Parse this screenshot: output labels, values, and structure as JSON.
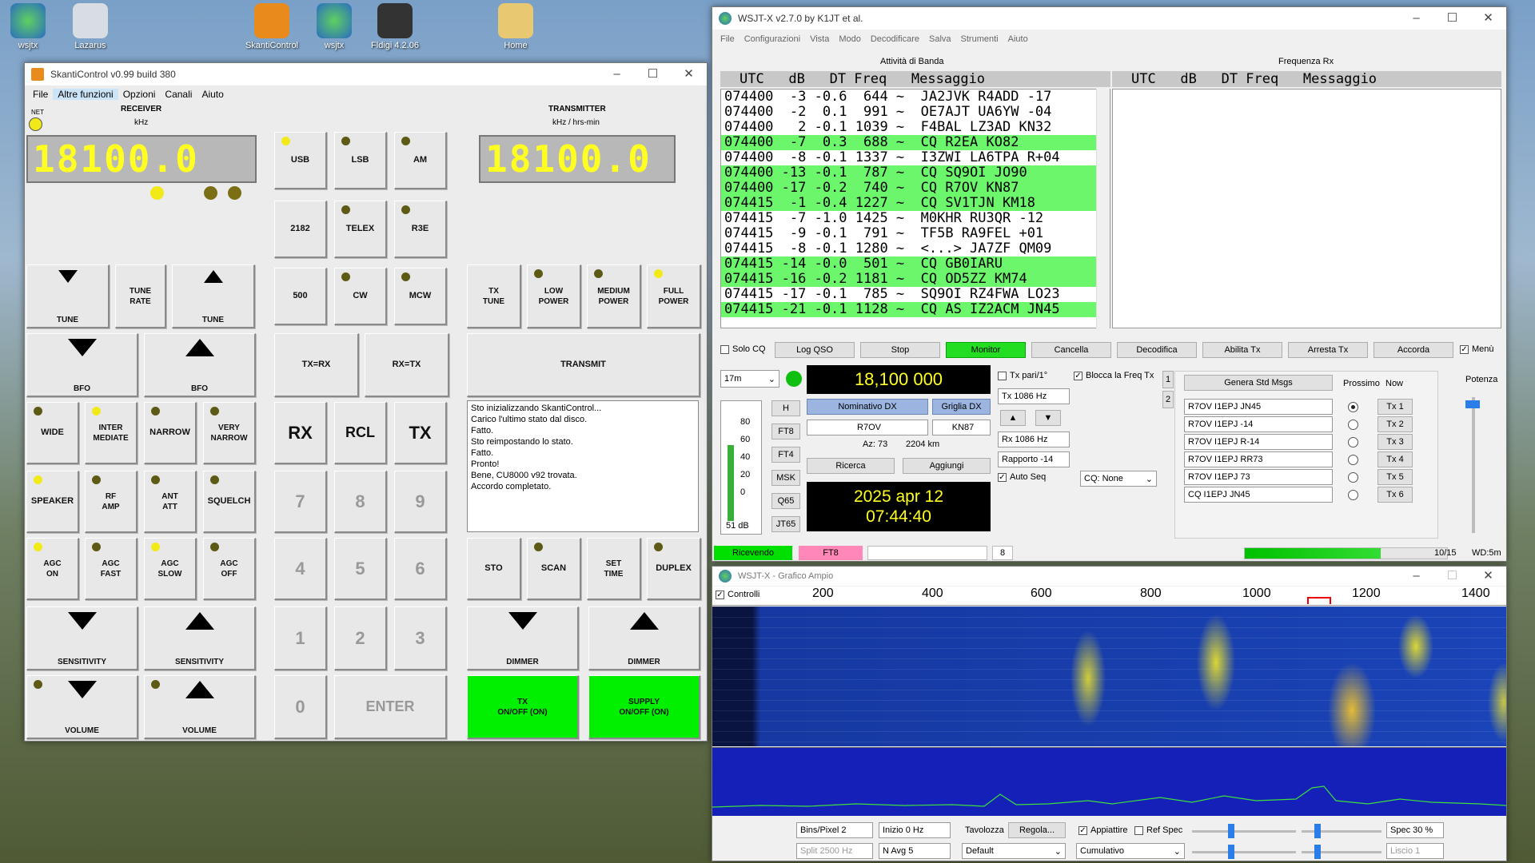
{
  "desktop": {
    "icons": [
      {
        "label": "wsjtx",
        "color": "#3a7bd5"
      },
      {
        "label": "Lazarus",
        "color": "#d8dde3"
      },
      {
        "label": "SkantiControl",
        "color": "#e88a1c"
      },
      {
        "label": "wsjtx",
        "color": "#3a7bd5"
      },
      {
        "label": "Fldigi 4.2.06",
        "color": "#333333"
      },
      {
        "label": "Home",
        "color": "#e8c870"
      }
    ]
  },
  "skanti": {
    "title": "SkantiControl v0.99 build 380",
    "menu": [
      "File",
      "Altre funzioni",
      "Opzioni",
      "Canali",
      "Aiuto"
    ],
    "receiver_label": "RECEIVER",
    "receiver_unit": "kHz",
    "net_label": "NET",
    "transmitter_label": "TRANSMITTER",
    "transmitter_unit": "kHz / hrs-min",
    "rx_freq": "18100.0",
    "tx_freq": "18100.0",
    "buttons": {
      "usb": "USB",
      "lsb": "LSB",
      "am": "AM",
      "f2182": "2182",
      "telex": "TELEX",
      "r3e": "R3E",
      "f500": "500",
      "cw": "CW",
      "mcw": "MCW",
      "tune_down": "TUNE",
      "tune_rate": "TUNE\nRATE",
      "tune_up": "TUNE",
      "tx_tune": "TX\nTUNE",
      "low_power": "LOW\nPOWER",
      "medium_power": "MEDIUM\nPOWER",
      "full_power": "FULL\nPOWER",
      "bfo_down": "BFO",
      "bfo_up": "BFO",
      "txrx": "TX=RX",
      "rxtx": "RX=TX",
      "transmit": "TRANSMIT",
      "wide": "WIDE",
      "intermediate": "INTER\nMEDIATE",
      "narrow": "NARROW",
      "very_narrow": "VERY\nNARROW",
      "rx": "RX",
      "rcl": "RCL",
      "tx": "TX",
      "speaker": "SPEAKER",
      "rf_amp": "RF\nAMP",
      "ant_att": "ANT\nATT",
      "squelch": "SQUELCH",
      "agc_on": "AGC\nON",
      "agc_fast": "AGC\nFAST",
      "agc_slow": "AGC\nSLOW",
      "agc_off": "AGC\nOFF",
      "sto": "STO",
      "scan": "SCAN",
      "set_time": "SET\nTIME",
      "duplex": "DUPLEX",
      "sens_down": "SENSITIVITY",
      "sens_up": "SENSITIVITY",
      "dimmer_down": "DIMMER",
      "dimmer_up": "DIMMER",
      "vol_down": "VOLUME",
      "vol_up": "VOLUME",
      "tx_onoff": "TX\nON/OFF (ON)",
      "supply_onoff": "SUPPLY\nON/OFF (ON)",
      "k7": "7",
      "k8": "8",
      "k9": "9",
      "k4": "4",
      "k5": "5",
      "k6": "6",
      "k1": "1",
      "k2": "2",
      "k3": "3",
      "k0": "0",
      "enter": "ENTER"
    },
    "log": [
      "Sto inizializzando SkantiControl...",
      "Carico l'ultimo stato dal disco.",
      "Fatto.",
      "Sto reimpostando lo stato.",
      "Fatto.",
      "Pronto!",
      "Bene, CU8000 v92 trovata.",
      "Accordo completato."
    ]
  },
  "wsjtx": {
    "title": "WSJT-X   v2.7.0   by K1JT et al.",
    "menu": [
      "File",
      "Configurazioni",
      "Vista",
      "Modo",
      "Decodificare",
      "Salva",
      "Strumenti",
      "Aiuto"
    ],
    "band_activity_label": "Attività di Banda",
    "rx_freq_label": "Frequenza Rx",
    "col_header": "UTC   dB   DT Freq   Messaggio",
    "decodes": [
      {
        "text": "074400  -3 -0.6  644 ~  JA2JVK R4ADD -17",
        "cq": false
      },
      {
        "text": "074400  -2  0.1  991 ~  OE7AJT UA6YW -04",
        "cq": false
      },
      {
        "text": "074400   2 -0.1 1039 ~  F4BAL LZ3AD KN32",
        "cq": false
      },
      {
        "text": "074400  -7  0.3  688 ~  CQ R2EA KO82",
        "cq": true
      },
      {
        "text": "074400  -8 -0.1 1337 ~  I3ZWI LA6TPA R+04",
        "cq": false
      },
      {
        "text": "074400 -13 -0.1  787 ~  CQ SQ9OI JO90",
        "cq": true
      },
      {
        "text": "074400 -17 -0.2  740 ~  CQ R7OV KN87",
        "cq": true
      },
      {
        "text": "074415  -1 -0.4 1227 ~  CQ SV1TJN KM18",
        "cq": true
      },
      {
        "text": "074415  -7 -1.0 1425 ~  M0KHR RU3QR -12",
        "cq": false
      },
      {
        "text": "074415  -9 -0.1  791 ~  TF5B RA9FEL +01",
        "cq": false
      },
      {
        "text": "074415  -8 -0.1 1280 ~  <...> JA7ZF QM09",
        "cq": false
      },
      {
        "text": "074415 -14 -0.0  501 ~  CQ GB0IARU",
        "cq": true
      },
      {
        "text": "074415 -16 -0.2 1181 ~  CQ OD5ZZ KM74",
        "cq": true
      },
      {
        "text": "074415 -17 -0.1  785 ~  SQ9OI RZ4FWA LO23",
        "cq": false
      },
      {
        "text": "074415 -21 -0.1 1128 ~  CQ AS IZ2ACM JN45",
        "cq": true
      }
    ],
    "checks": {
      "solo_cq": "Solo CQ",
      "menu": "Menù",
      "tx_even": "Tx pari/1°",
      "lock_tx": "Blocca la Freq Tx",
      "auto_seq": "Auto Seq"
    },
    "buttons": {
      "log_qso": "Log QSO",
      "stop": "Stop",
      "monitor": "Monitor",
      "erase": "Cancella",
      "decode": "Decodifica",
      "enable_tx": "Abilita Tx",
      "halt_tx": "Arresta Tx",
      "tune": "Accorda"
    },
    "band": "17m",
    "freq_display": "18,100 000",
    "modes": [
      "H",
      "FT8",
      "FT4",
      "MSK",
      "Q65",
      "JT65"
    ],
    "meter_ticks": [
      "80",
      "60",
      "40",
      "20",
      "0"
    ],
    "meter_db": "51 dB",
    "dx_call_label": "Nominativo DX",
    "dx_grid_label": "Griglia DX",
    "dx_call": "R7OV",
    "dx_grid": "KN87",
    "az": "Az: 73",
    "dist": "2204 km",
    "lookup": "Ricerca",
    "add": "Aggiungi",
    "date": "2025 apr 12",
    "time": "07:44:40",
    "tx_hz": "Tx  1086  Hz",
    "rx_hz": "Rx  1086  Hz",
    "report": "Rapporto -14",
    "cq_none": "CQ: None",
    "tabs": [
      "1",
      "2"
    ],
    "gen_std": "Genera Std Msgs",
    "next_label": "Prossimo",
    "now_label": "Now",
    "tx_msgs": [
      "R7OV I1EPJ JN45",
      "R7OV I1EPJ -14",
      "R7OV I1EPJ R-14",
      "R7OV I1EPJ RR73",
      "R7OV I1EPJ 73",
      "CQ I1EPJ JN45"
    ],
    "tx_btns": [
      "Tx 1",
      "Tx 2",
      "Tx 3",
      "Tx 4",
      "Tx 5",
      "Tx 6"
    ],
    "power_label": "Potenza",
    "status": {
      "receiving": "Ricevendo",
      "mode": "FT8",
      "count": "8",
      "progress": "10/15",
      "wd": "WD:5m"
    },
    "progress_fraction": 0.67
  },
  "wide": {
    "title": "WSJT-X - Grafico Ampio",
    "controls": "Controlli",
    "ticks": [
      "200",
      "400",
      "600",
      "800",
      "1000",
      "1200",
      "1400"
    ],
    "bins": "Bins/Pixel  2",
    "start": "Inizio 0 Hz",
    "split": "Split  2500  Hz",
    "navg": "N Avg 5",
    "palette_label": "Tavolozza",
    "adjust": "Regola...",
    "palette": "Default",
    "flatten": "Appiattire",
    "ref_spec": "Ref Spec",
    "cumulative": "Cumulativo",
    "spec": "Spec 30 %",
    "smooth": "Liscio  1"
  },
  "colors": {
    "cq_green": "#6cf66c",
    "lcd_yellow": "#ffff22",
    "led_on": "#f2ea18",
    "btn_green": "#00f000"
  }
}
